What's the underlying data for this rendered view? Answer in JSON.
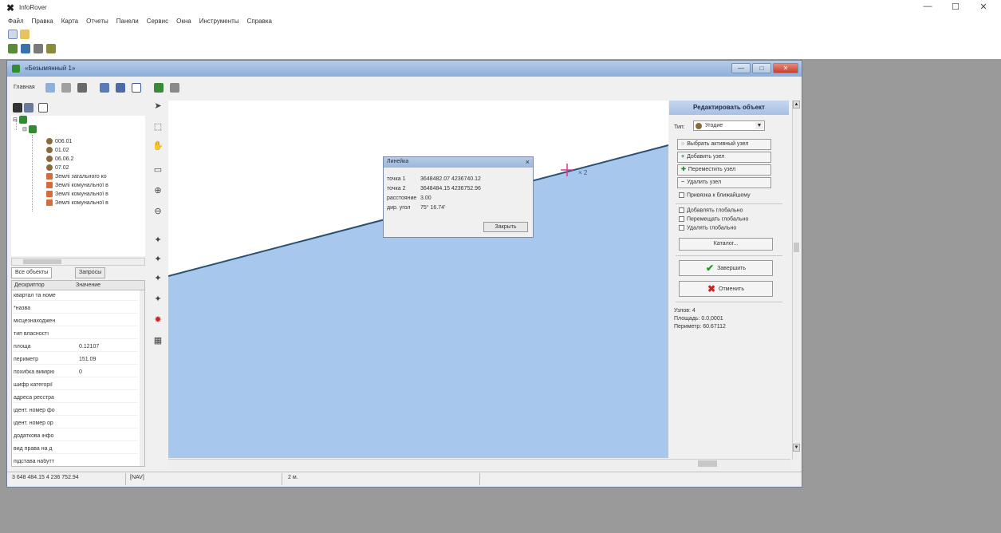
{
  "app": {
    "title": "InfoRover"
  },
  "window_controls": {
    "minimize": "—",
    "maximize": "☐",
    "close": "✕"
  },
  "menu": [
    "Файл",
    "Правка",
    "Карта",
    "Отчеты",
    "Панели",
    "Сервис",
    "Окна",
    "Инструменты",
    "Справка"
  ],
  "mdi": {
    "title": "«Безымянный 1»",
    "toolbar_label": "Главная",
    "controls": {
      "minimize": "—",
      "maximize": "□",
      "close": "✕"
    }
  },
  "tree": {
    "nodes": [
      "006.01",
      "01.02",
      "06.06.2",
      "07.02",
      "Землі загального ко",
      "Землі комунальної в",
      "Землі комунальної в",
      "Землі комунальної в"
    ]
  },
  "tabs": [
    "Все объекты",
    "Запросы"
  ],
  "properties": {
    "headers": [
      "Дескриптор",
      "Значение"
    ],
    "rows": [
      {
        "key": "квартал та номе",
        "value": ""
      },
      {
        "key": "*назва",
        "value": ""
      },
      {
        "key": "місцезнаходжен",
        "value": ""
      },
      {
        "key": "тип власності",
        "value": ""
      },
      {
        "key": "площа",
        "value": "0.12107"
      },
      {
        "key": "периметр",
        "value": "151.09"
      },
      {
        "key": "похибка вимірю",
        "value": "0"
      },
      {
        "key": "шифр категорії",
        "value": ""
      },
      {
        "key": "адреса реєстра",
        "value": ""
      },
      {
        "key": "ідент. номер фо",
        "value": ""
      },
      {
        "key": "ідент. номер ор",
        "value": ""
      },
      {
        "key": "додаткова інфо",
        "value": ""
      },
      {
        "key": "вид права на д",
        "value": ""
      },
      {
        "key": "підстава набутт",
        "value": ""
      }
    ]
  },
  "map": {
    "marker_label": "× 2"
  },
  "dialog": {
    "title": "Линейка",
    "close_icon": "×",
    "rows": [
      {
        "key": "точка 1",
        "value": "3648482.07 4236740.12"
      },
      {
        "key": "точка 2",
        "value": "3648484.15 4236752.96"
      },
      {
        "key": "расстояние",
        "value": "3.00"
      },
      {
        "key": "дир. угол",
        "value": "75° 16.74'"
      }
    ],
    "close_button": "Закрыть"
  },
  "edit_panel": {
    "title": "Редактировать объект",
    "type_label": "Тип:",
    "type_value": "Угодие",
    "buttons": [
      {
        "icon": "○",
        "label": "Выбрать активный узел"
      },
      {
        "icon": "+",
        "label": "Добавить узел"
      },
      {
        "icon": "✚",
        "label": "Переместить узел"
      },
      {
        "icon": "−",
        "label": "Удалить узел"
      }
    ],
    "snap_checkbox": "Привязка к ближайшему",
    "checkboxes": [
      "Добавлять глобально",
      "Перемещать глобально",
      "Удалять глобально"
    ],
    "catalog_button": "Каталог...",
    "finish_button": "Завершить",
    "cancel_button": "Отменить",
    "stats": [
      "Узлов: 4",
      "Площадь: 0.0,0001",
      "Периметр: 60.67112"
    ]
  },
  "status": {
    "coords": "3 648 484.15 4 236 752.94",
    "mode": "[NAV]",
    "scale": "2 м."
  },
  "colors": {
    "map_fill": "#a7c8ec",
    "line": "#2b4f6e",
    "marker": "#e0348f"
  }
}
